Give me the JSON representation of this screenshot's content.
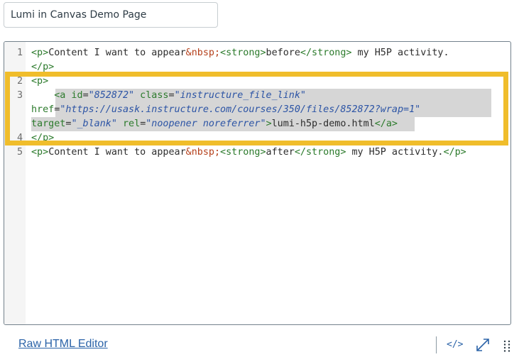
{
  "title_input": {
    "value": "Lumi in Canvas Demo Page"
  },
  "editor": {
    "line_numbers": [
      "1",
      "2",
      "3",
      "4",
      "5"
    ],
    "line1": {
      "tag_open_p": "<p>",
      "text1": "Content I want to appear",
      "entity": "&nbsp;",
      "tag_open_strong": "<strong>",
      "strong_text": "before",
      "tag_close_strong": "</strong>",
      "text2": " my H5P activity.",
      "tag_close_p": "</p>"
    },
    "line2": {
      "tag_open_p": "<p>"
    },
    "line3": {
      "indent": "    ",
      "tag_open_a": "<a",
      "attr_id": " id",
      "eq1": "=",
      "val_id": "\"852872\"",
      "attr_class": " class",
      "eq2": "=",
      "val_class": "\"instructure_file_link\"",
      "attr_href": "href",
      "eq3": "=",
      "val_href": "\"https://usask.instructure.com/courses/350/files/852872?wrap=1\"",
      "attr_target": "target",
      "eq4": "=",
      "val_target": "\"_blank\"",
      "attr_rel": " rel",
      "eq5": "=",
      "val_rel": "\"noopener noreferrer\"",
      "tag_gt": ">",
      "link_text": "lumi-h5p-demo.html",
      "tag_close_a": "</a>"
    },
    "line4": {
      "tag_close_p": "</p>"
    },
    "line5": {
      "tag_open_p": "<p>",
      "text1": "Content I want to appear",
      "entity": "&nbsp;",
      "tag_open_strong": "<strong>",
      "strong_text": "after",
      "tag_close_strong": "</strong>",
      "text2": " my H5P activity.",
      "tag_close_p": "</p>"
    }
  },
  "footer": {
    "raw_html_editor_label": "Raw HTML Editor",
    "html_toggle_label": "</>",
    "expand_icon": "expand-diagonal-arrows",
    "resize_icon": "drag-handle-dots"
  },
  "colors": {
    "highlight_border": "#f0bd2b",
    "link": "#2b63a8",
    "tag": "#2b7a2b",
    "entity": "#b5401b",
    "attr_value": "#2c54a5"
  }
}
